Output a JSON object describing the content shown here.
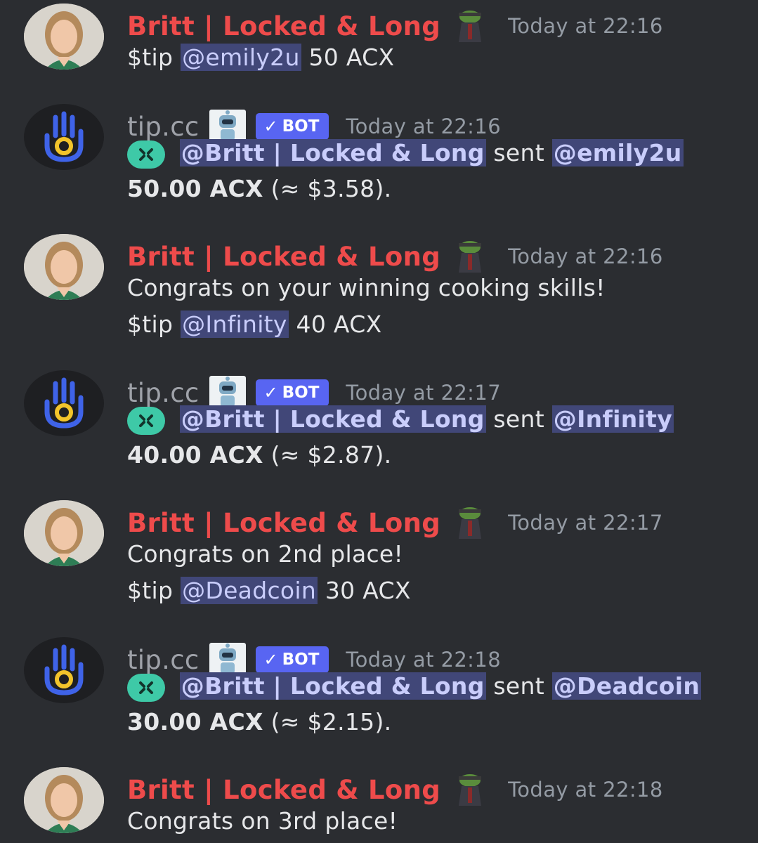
{
  "messages": [
    {
      "type": "user",
      "author": "Britt | Locked & Long",
      "time": "Today at 22:16",
      "lines": [
        {
          "text_before": "$tip",
          "mention": "@emily2u",
          "text_after": "50 ACX"
        }
      ]
    },
    {
      "type": "bot",
      "author": "tip.cc",
      "bot_tag": "BOT",
      "time": "Today at 22:16",
      "sender": "@Britt | Locked & Long",
      "verb": "sent",
      "recipient": "@emily2u",
      "amount": "50.00 ACX",
      "value": "(≈ $3.58)."
    },
    {
      "type": "user",
      "author": "Britt | Locked & Long",
      "time": "Today at 22:16",
      "text": "Congrats on your winning cooking skills!",
      "lines": [
        {
          "text_before": "$tip",
          "mention": "@Infinity",
          "text_after": "40 ACX"
        }
      ]
    },
    {
      "type": "bot",
      "author": "tip.cc",
      "bot_tag": "BOT",
      "time": "Today at 22:17",
      "sender": "@Britt | Locked & Long",
      "verb": "sent",
      "recipient": "@Infinity",
      "amount": "40.00 ACX",
      "value": "(≈ $2.87)."
    },
    {
      "type": "user",
      "author": "Britt | Locked & Long",
      "time": "Today at 22:17",
      "text": "Congrats on 2nd place!",
      "lines": [
        {
          "text_before": "$tip",
          "mention": "@Deadcoin",
          "text_after": "30 ACX"
        }
      ]
    },
    {
      "type": "bot",
      "author": "tip.cc",
      "bot_tag": "BOT",
      "time": "Today at 22:18",
      "sender": "@Britt | Locked & Long",
      "verb": "sent",
      "recipient": "@Deadcoin",
      "amount": "30.00 ACX",
      "value": "(≈ $2.15)."
    },
    {
      "type": "user",
      "author": "Britt | Locked & Long",
      "time": "Today at 22:18",
      "text": "Congrats on 3rd place!"
    }
  ],
  "colors": {
    "background": "#2b2d31",
    "user_name": "#ee4b4b",
    "bot_name": "#9fa2a9",
    "timestamp": "#949ba4",
    "mention_bg": "#414778",
    "mention_text": "#c9cdfb",
    "bot_tag": "#5865f2",
    "emoji_bg": "#3ec9a7"
  },
  "icons": {
    "user_avatar": "woman-portrait-avatar",
    "bot_avatar": "tipcc-hand-icon",
    "role_icon": "pepe-frog-icon",
    "bot_app_icon": "robot-icon",
    "verified": "checkmark-icon",
    "tip_emoji": "acx-x-emoji-icon"
  }
}
